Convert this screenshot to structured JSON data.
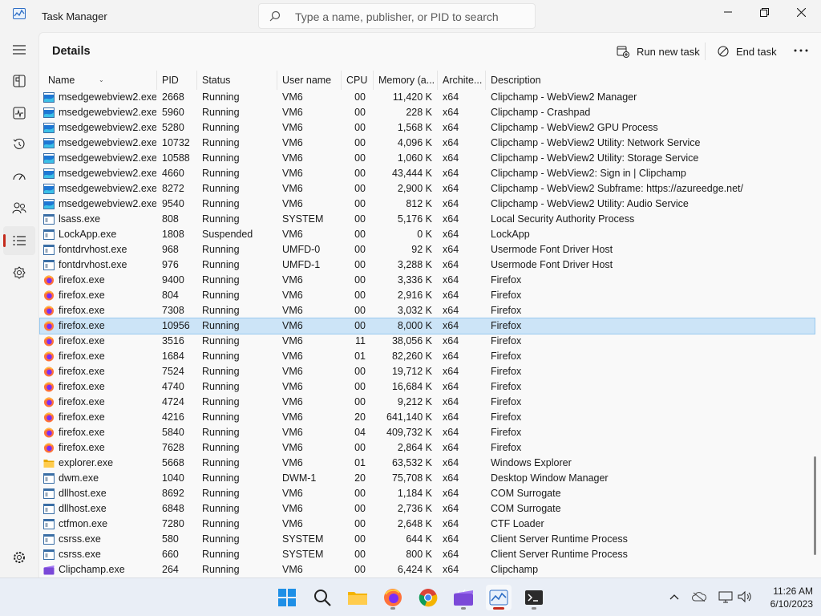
{
  "window": {
    "title": "Task Manager",
    "search_placeholder": "Type a name, publisher, or PID to search"
  },
  "page": {
    "title": "Details",
    "run_new_task": "Run new task",
    "end_task": "End task"
  },
  "columns": {
    "name": "Name",
    "pid": "PID",
    "status": "Status",
    "user": "User name",
    "cpu": "CPU",
    "memory": "Memory (a...",
    "arch": "Archite...",
    "description": "Description"
  },
  "rows": [
    {
      "name": "msedgewebview2.exe",
      "icon": "webview-icon",
      "pid": "2668",
      "status": "Running",
      "user": "VM6",
      "cpu": "00",
      "memory": "11,420 K",
      "arch": "x64",
      "description": "Clipchamp - WebView2 Manager"
    },
    {
      "name": "msedgewebview2.exe",
      "icon": "webview-icon",
      "pid": "5960",
      "status": "Running",
      "user": "VM6",
      "cpu": "00",
      "memory": "228 K",
      "arch": "x64",
      "description": "Clipchamp - Crashpad"
    },
    {
      "name": "msedgewebview2.exe",
      "icon": "webview-icon",
      "pid": "5280",
      "status": "Running",
      "user": "VM6",
      "cpu": "00",
      "memory": "1,568 K",
      "arch": "x64",
      "description": "Clipchamp - WebView2 GPU Process"
    },
    {
      "name": "msedgewebview2.exe",
      "icon": "webview-icon",
      "pid": "10732",
      "status": "Running",
      "user": "VM6",
      "cpu": "00",
      "memory": "4,096 K",
      "arch": "x64",
      "description": "Clipchamp - WebView2 Utility: Network Service"
    },
    {
      "name": "msedgewebview2.exe",
      "icon": "webview-icon",
      "pid": "10588",
      "status": "Running",
      "user": "VM6",
      "cpu": "00",
      "memory": "1,060 K",
      "arch": "x64",
      "description": "Clipchamp - WebView2 Utility: Storage Service"
    },
    {
      "name": "msedgewebview2.exe",
      "icon": "webview-icon",
      "pid": "4660",
      "status": "Running",
      "user": "VM6",
      "cpu": "00",
      "memory": "43,444 K",
      "arch": "x64",
      "description": "Clipchamp - WebView2: Sign in | Clipchamp"
    },
    {
      "name": "msedgewebview2.exe",
      "icon": "webview-icon",
      "pid": "8272",
      "status": "Running",
      "user": "VM6",
      "cpu": "00",
      "memory": "2,900 K",
      "arch": "x64",
      "description": "Clipchamp - WebView2 Subframe: https://azureedge.net/"
    },
    {
      "name": "msedgewebview2.exe",
      "icon": "webview-icon",
      "pid": "9540",
      "status": "Running",
      "user": "VM6",
      "cpu": "00",
      "memory": "812 K",
      "arch": "x64",
      "description": "Clipchamp - WebView2 Utility: Audio Service"
    },
    {
      "name": "lsass.exe",
      "icon": "system-app-icon",
      "pid": "808",
      "status": "Running",
      "user": "SYSTEM",
      "cpu": "00",
      "memory": "5,176 K",
      "arch": "x64",
      "description": "Local Security Authority Process"
    },
    {
      "name": "LockApp.exe",
      "icon": "system-app-icon",
      "pid": "1808",
      "status": "Suspended",
      "user": "VM6",
      "cpu": "00",
      "memory": "0 K",
      "arch": "x64",
      "description": "LockApp"
    },
    {
      "name": "fontdrvhost.exe",
      "icon": "system-app-icon",
      "pid": "968",
      "status": "Running",
      "user": "UMFD-0",
      "cpu": "00",
      "memory": "92 K",
      "arch": "x64",
      "description": "Usermode Font Driver Host"
    },
    {
      "name": "fontdrvhost.exe",
      "icon": "system-app-icon",
      "pid": "976",
      "status": "Running",
      "user": "UMFD-1",
      "cpu": "00",
      "memory": "3,288 K",
      "arch": "x64",
      "description": "Usermode Font Driver Host"
    },
    {
      "name": "firefox.exe",
      "icon": "firefox-icon",
      "pid": "9400",
      "status": "Running",
      "user": "VM6",
      "cpu": "00",
      "memory": "3,336 K",
      "arch": "x64",
      "description": "Firefox"
    },
    {
      "name": "firefox.exe",
      "icon": "firefox-icon",
      "pid": "804",
      "status": "Running",
      "user": "VM6",
      "cpu": "00",
      "memory": "2,916 K",
      "arch": "x64",
      "description": "Firefox"
    },
    {
      "name": "firefox.exe",
      "icon": "firefox-icon",
      "pid": "7308",
      "status": "Running",
      "user": "VM6",
      "cpu": "00",
      "memory": "3,032 K",
      "arch": "x64",
      "description": "Firefox"
    },
    {
      "name": "firefox.exe",
      "icon": "firefox-icon",
      "pid": "10956",
      "status": "Running",
      "user": "VM6",
      "cpu": "00",
      "memory": "8,000 K",
      "arch": "x64",
      "description": "Firefox",
      "selected": true
    },
    {
      "name": "firefox.exe",
      "icon": "firefox-icon",
      "pid": "3516",
      "status": "Running",
      "user": "VM6",
      "cpu": "11",
      "memory": "38,056 K",
      "arch": "x64",
      "description": "Firefox"
    },
    {
      "name": "firefox.exe",
      "icon": "firefox-icon",
      "pid": "1684",
      "status": "Running",
      "user": "VM6",
      "cpu": "01",
      "memory": "82,260 K",
      "arch": "x64",
      "description": "Firefox"
    },
    {
      "name": "firefox.exe",
      "icon": "firefox-icon",
      "pid": "7524",
      "status": "Running",
      "user": "VM6",
      "cpu": "00",
      "memory": "19,712 K",
      "arch": "x64",
      "description": "Firefox"
    },
    {
      "name": "firefox.exe",
      "icon": "firefox-icon",
      "pid": "4740",
      "status": "Running",
      "user": "VM6",
      "cpu": "00",
      "memory": "16,684 K",
      "arch": "x64",
      "description": "Firefox"
    },
    {
      "name": "firefox.exe",
      "icon": "firefox-icon",
      "pid": "4724",
      "status": "Running",
      "user": "VM6",
      "cpu": "00",
      "memory": "9,212 K",
      "arch": "x64",
      "description": "Firefox"
    },
    {
      "name": "firefox.exe",
      "icon": "firefox-icon",
      "pid": "4216",
      "status": "Running",
      "user": "VM6",
      "cpu": "20",
      "memory": "641,140 K",
      "arch": "x64",
      "description": "Firefox"
    },
    {
      "name": "firefox.exe",
      "icon": "firefox-icon",
      "pid": "5840",
      "status": "Running",
      "user": "VM6",
      "cpu": "04",
      "memory": "409,732 K",
      "arch": "x64",
      "description": "Firefox"
    },
    {
      "name": "firefox.exe",
      "icon": "firefox-icon",
      "pid": "7628",
      "status": "Running",
      "user": "VM6",
      "cpu": "00",
      "memory": "2,864 K",
      "arch": "x64",
      "description": "Firefox"
    },
    {
      "name": "explorer.exe",
      "icon": "folder-icon",
      "pid": "5668",
      "status": "Running",
      "user": "VM6",
      "cpu": "01",
      "memory": "63,532 K",
      "arch": "x64",
      "description": "Windows Explorer"
    },
    {
      "name": "dwm.exe",
      "icon": "system-app-icon",
      "pid": "1040",
      "status": "Running",
      "user": "DWM-1",
      "cpu": "20",
      "memory": "75,708 K",
      "arch": "x64",
      "description": "Desktop Window Manager"
    },
    {
      "name": "dllhost.exe",
      "icon": "system-app-icon",
      "pid": "8692",
      "status": "Running",
      "user": "VM6",
      "cpu": "00",
      "memory": "1,184 K",
      "arch": "x64",
      "description": "COM Surrogate"
    },
    {
      "name": "dllhost.exe",
      "icon": "system-app-icon",
      "pid": "6848",
      "status": "Running",
      "user": "VM6",
      "cpu": "00",
      "memory": "2,736 K",
      "arch": "x64",
      "description": "COM Surrogate"
    },
    {
      "name": "ctfmon.exe",
      "icon": "system-app-icon",
      "pid": "7280",
      "status": "Running",
      "user": "VM6",
      "cpu": "00",
      "memory": "2,648 K",
      "arch": "x64",
      "description": "CTF Loader"
    },
    {
      "name": "csrss.exe",
      "icon": "system-app-icon",
      "pid": "580",
      "status": "Running",
      "user": "SYSTEM",
      "cpu": "00",
      "memory": "644 K",
      "arch": "x64",
      "description": "Client Server Runtime Process"
    },
    {
      "name": "csrss.exe",
      "icon": "system-app-icon",
      "pid": "660",
      "status": "Running",
      "user": "SYSTEM",
      "cpu": "00",
      "memory": "800 K",
      "arch": "x64",
      "description": "Client Server Runtime Process"
    },
    {
      "name": "Clipchamp.exe",
      "icon": "clipchamp-icon",
      "pid": "264",
      "status": "Running",
      "user": "VM6",
      "cpu": "00",
      "memory": "6,424 K",
      "arch": "x64",
      "description": "Clipchamp"
    }
  ],
  "sidebar": [
    "hamburger-icon",
    "processes-icon",
    "performance-icon",
    "app-history-icon",
    "startup-apps-icon",
    "users-icon",
    "details-icon",
    "services-icon",
    "settings-icon"
  ],
  "taskbar": {
    "time": "11:26 AM",
    "date": "6/10/2023"
  },
  "colors": {
    "accent": "#c42b1c",
    "selection": "#cce4f7",
    "firefox": "#ff7139"
  }
}
